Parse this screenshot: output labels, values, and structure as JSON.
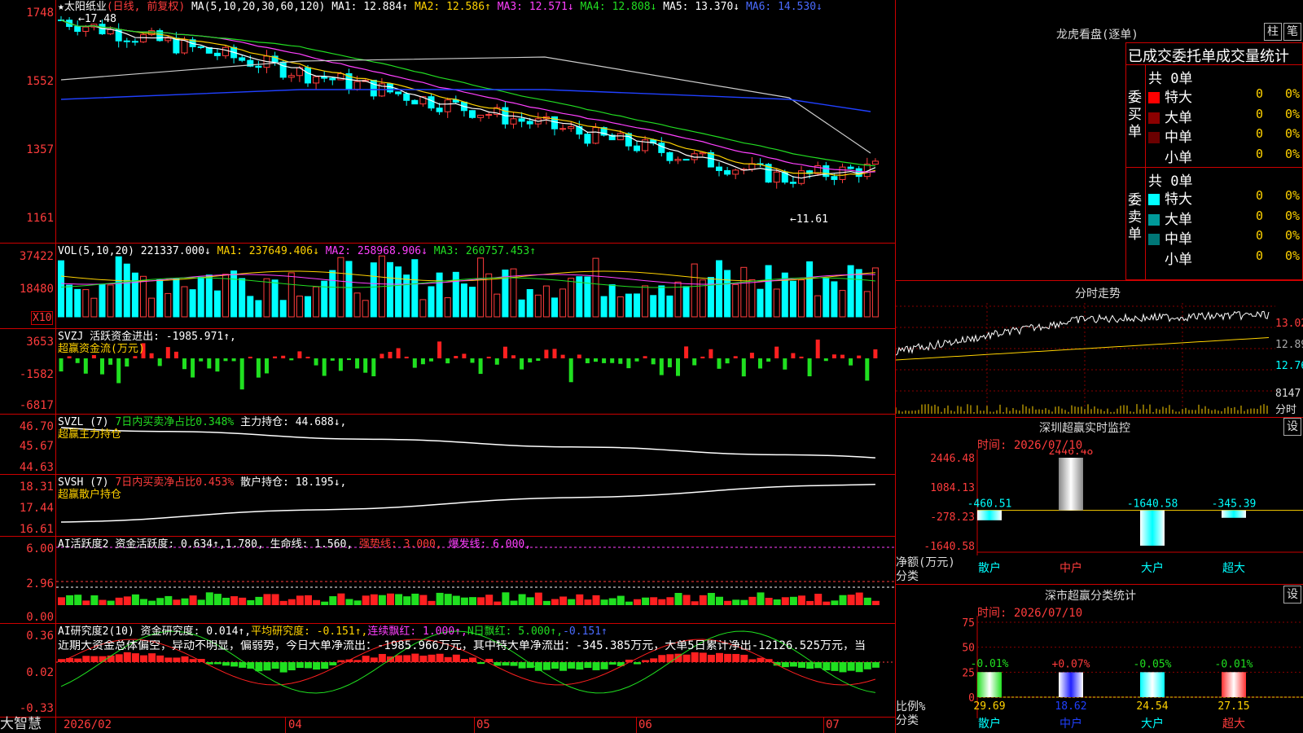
{
  "header": {
    "stock_star": "★",
    "stock_name": "太阳纸业",
    "mode": "(日线, 前复权)",
    "ma_params": "MA(5,10,20,30,60,120)",
    "ma1": "MA1: 12.884↑",
    "ma2": "MA2: 12.586↑",
    "ma3": "MA3: 12.571↓",
    "ma4": "MA4: 12.808↓",
    "ma5": "MA5: 13.370↓",
    "ma6": "MA6: 14.530↓",
    "high_mark": "←17.48",
    "low_mark": "←11.61"
  },
  "price_axis": [
    "1748",
    "1552",
    "1357",
    "1161"
  ],
  "vol": {
    "title": "VOL(5,10,20)",
    "value": "221337.000↓",
    "ma1": "MA1: 237649.406↓",
    "ma2": "MA2: 258968.906↓",
    "ma3": "MA3: 260757.453↑",
    "axis": [
      "37422",
      "18480"
    ],
    "unit": "X10"
  },
  "svzj": {
    "title": "SVZJ",
    "text": "活跃资金进出: -1985.971↑,",
    "sub": "超赢资金流(万元)",
    "axis": [
      "3653",
      "-1582",
      "-6817"
    ]
  },
  "svzl": {
    "title": "SVZL (7)",
    "text": "7日内买卖净占比0.348%",
    "text2": "主力持仓: 44.688↓,",
    "sub": "超赢主力持仓",
    "axis": [
      "46.70",
      "45.67",
      "44.63"
    ]
  },
  "svsh": {
    "title": "SVSH (7)",
    "text": "7日内买卖净占比0.453%",
    "text2": "散户持仓: 18.195↓,",
    "sub": "超赢散户持仓",
    "axis": [
      "18.31",
      "17.44",
      "16.61"
    ]
  },
  "ai_active": {
    "title": "AI活跃度2",
    "t1": "资金活跃度: 0.634↑,",
    "t2": "1.780,",
    "t3": "生命线: 1.560,",
    "t4": "强势线: 3.000,",
    "t5": "爆发线: 6.000,",
    "axis": [
      "6.00",
      "2.96",
      "0.00"
    ]
  },
  "ai_research": {
    "title": "AI研究度2(10)",
    "t1": "资金研究度: 0.014↑,",
    "t2": "平均研究度: -0.151↑,",
    "t3": "连续飘红: 1.000↑,",
    "t4": "N日飘红: 5.000↑,",
    "t5": "-0.151↑",
    "comment": "近期大资金总体偏空，异动不明显，偏弱势，今日大单净流出：-1985.966万元，其中特大单净流出：-345.385万元，大单5日累计净出-12126.525万元，当",
    "axis": [
      "0.36",
      "0.02",
      "-0.33"
    ]
  },
  "dates": [
    "2026/02",
    "04",
    "05",
    "06",
    "07"
  ],
  "brand": "大智慧",
  "right": {
    "lhb_title": "龙虎看盘(逐单)",
    "btn_zhu": "柱",
    "btn_bi": "笔",
    "stat_title": "已成交委托单成交量统计",
    "buy_label": "委买单",
    "sell_label": "委卖单",
    "buy_total": "共 0单",
    "sell_total": "共 0单",
    "buy_rows": [
      {
        "name": "特大",
        "n": "0",
        "p": "0%",
        "color": "#ff0000"
      },
      {
        "name": "大单",
        "n": "0",
        "p": "0%",
        "color": "#8b0000"
      },
      {
        "name": "中单",
        "n": "0",
        "p": "0%",
        "color": "#6b0000"
      },
      {
        "name": "小单",
        "n": "0",
        "p": "0%",
        "color": "#000000"
      }
    ],
    "sell_rows": [
      {
        "name": "特大",
        "n": "0",
        "p": "0%",
        "color": "#00ffff"
      },
      {
        "name": "大单",
        "n": "0",
        "p": "0%",
        "color": "#009999"
      },
      {
        "name": "中单",
        "n": "0",
        "p": "0%",
        "color": "#007777"
      },
      {
        "name": "小单",
        "n": "0",
        "p": "0%",
        "color": "#000000"
      }
    ],
    "fs_title": "分时走势",
    "fs_axis": [
      "13.02",
      "12.89",
      "12.76"
    ],
    "fs_vol": "8147",
    "fs_vol_unit": "分时",
    "mon_title": "深圳超赢实时监控",
    "set": "设",
    "time": "时间: 2026/07/10",
    "mon_axis": [
      "2446.48",
      "1084.13",
      "-278.23",
      "-1640.58"
    ],
    "mon_unit": "净额(万元)",
    "mon_cat_label": "分类",
    "mon_cats": [
      "散户",
      "中户",
      "大户",
      "超大"
    ],
    "mon_vals": [
      "-460.51",
      "2446.48",
      "-1640.58",
      "-345.39"
    ],
    "cls_title": "深市超赢分类统计",
    "cls_time": "时间: 2026/07/10",
    "cls_axis": [
      "75",
      "50",
      "25",
      "0"
    ],
    "cls_unit": "比例%",
    "cls_cat_label": "分类",
    "cls_pct": [
      "-0.01%",
      "+0.07%",
      "-0.05%",
      "-0.01%"
    ],
    "cls_vals": [
      "29.69",
      "18.62",
      "24.54",
      "27.15"
    ]
  },
  "chart_data": [
    {
      "type": "bar",
      "title": "深圳超赢实时监控",
      "ylabel": "净额(万元)",
      "xlabel": "分类",
      "categories": [
        "散户",
        "中户",
        "大户",
        "超大"
      ],
      "values": [
        -460.51,
        2446.48,
        -1640.58,
        -345.39
      ],
      "ylim": [
        -1640.58,
        2446.48
      ]
    },
    {
      "type": "bar",
      "title": "深市超赢分类统计",
      "ylabel": "比例%",
      "xlabel": "分类",
      "categories": [
        "散户",
        "中户",
        "大户",
        "超大"
      ],
      "values": [
        29.69,
        18.62,
        24.54,
        27.15
      ],
      "ylim": [
        0,
        75
      ]
    }
  ]
}
